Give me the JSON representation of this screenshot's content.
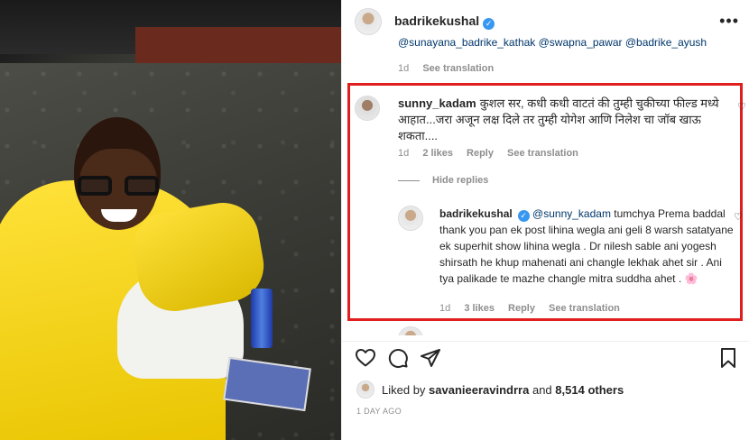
{
  "post": {
    "username": "badrikekushal",
    "more_icon": "more-horizontal-icon"
  },
  "caption_tail": {
    "mentions": "@sunayana_badrike_kathak @swapna_pawar @badrike_ayush",
    "time": "1d",
    "see_translation": "See translation"
  },
  "comment": {
    "username": "sunny_kadam",
    "text": "कुशल सर, कधी कधी वाटतं की तुम्ही चुकीच्या फील्ड मध्ये आहात...जरा अजून लक्ष दिले तर तुम्ही योगेश आणि निलेश चा जॉब खाऊ शकता....",
    "time": "1d",
    "likes": "2 likes",
    "reply": "Reply",
    "see_translation": "See translation"
  },
  "hide_replies": "Hide replies",
  "reply": {
    "username": "badrikekushal",
    "mention": "@sunny_kadam",
    "text": "tumchya Prema baddal thank you pan ek post lihina wegla ani geli 8 warsh satatyane ek superhit show lihina wegla . Dr nilesh sable ani yogesh shirsath he khup mahenati ani changle lekhak ahet sir . Ani tya palikade te mazhe changle mitra suddha ahet .",
    "emoji": "🌸",
    "time": "1d",
    "likes": "3 likes",
    "reply_label": "Reply",
    "see_translation": "See translation"
  },
  "actions": {
    "like_icon": "heart-icon",
    "comment_icon": "comment-icon",
    "share_icon": "send-icon",
    "save_icon": "bookmark-icon"
  },
  "likes": {
    "prefix": "Liked by",
    "user": "savanieeravindrra",
    "and": "and",
    "others": "8,514 others"
  },
  "date": "1 DAY AGO",
  "colors": {
    "highlight_border": "#e01e1e",
    "verified": "#3897f0",
    "mention": "#00376b"
  }
}
